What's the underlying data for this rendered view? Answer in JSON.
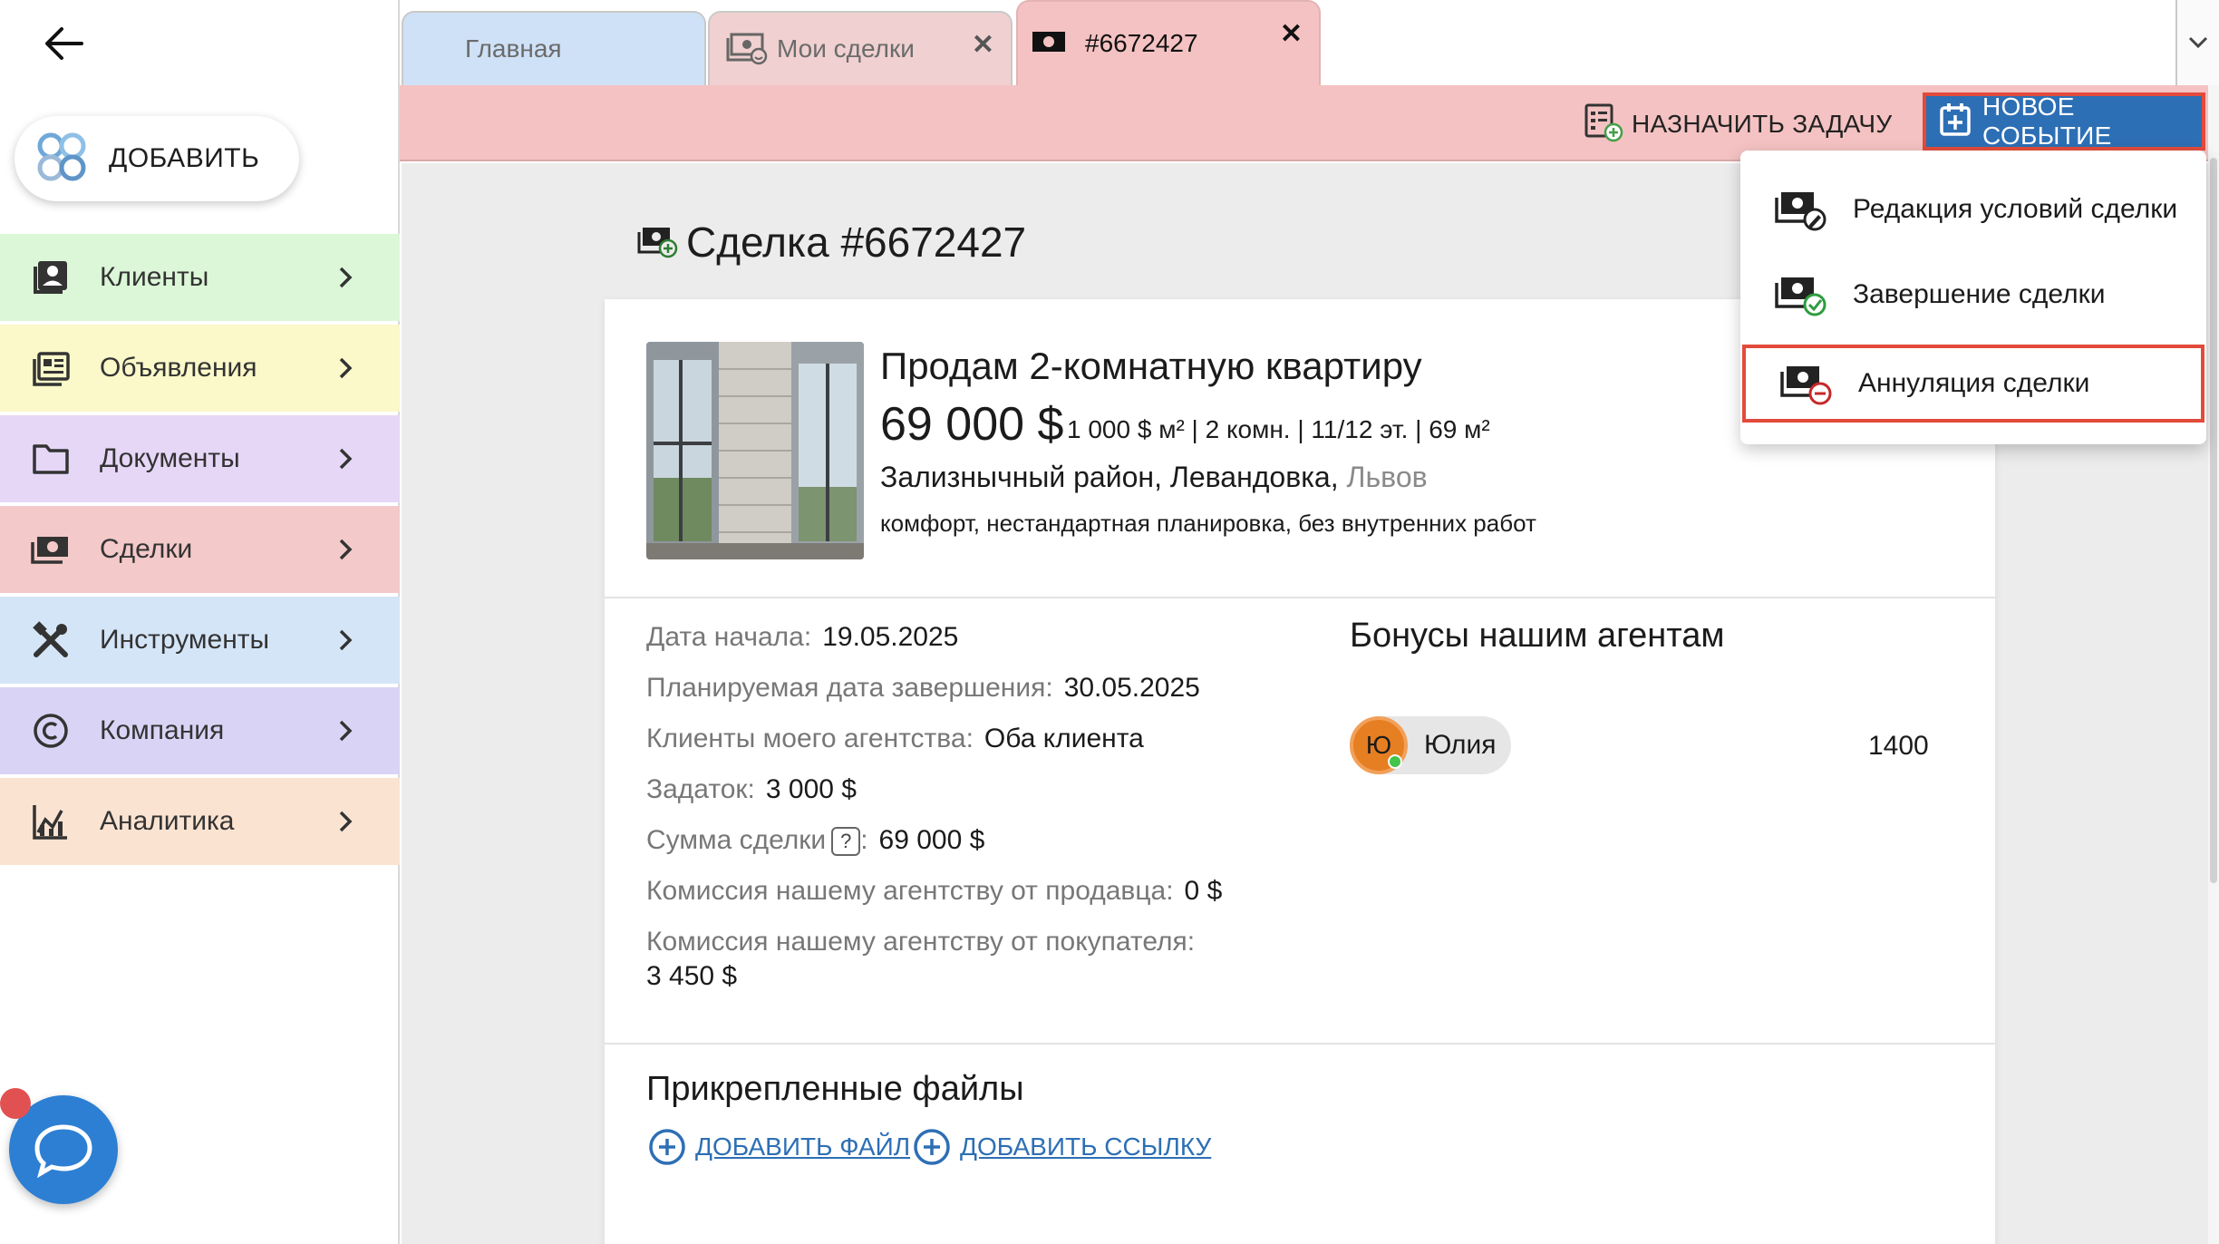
{
  "sidebar": {
    "add_label": "ДОБАВИТЬ",
    "items": [
      {
        "label": "Клиенты",
        "bg": "#dcf7d8",
        "icon": "contacts-icon"
      },
      {
        "label": "Объявления",
        "bg": "#fbf8c9",
        "icon": "listings-icon"
      },
      {
        "label": "Документы",
        "bg": "#e6d7f7",
        "icon": "folder-icon"
      },
      {
        "label": "Сделки",
        "bg": "#f4c9c9",
        "icon": "money-icon"
      },
      {
        "label": "Инструменты",
        "bg": "#d5e5f8",
        "icon": "tools-icon"
      },
      {
        "label": "Компания",
        "bg": "#d9d4f5",
        "icon": "copyright-icon"
      },
      {
        "label": "Аналитика",
        "bg": "#fbe3d2",
        "icon": "analytics-icon"
      }
    ]
  },
  "tabs": [
    {
      "label": "Главная"
    },
    {
      "label": "Мои сделки",
      "close": "✕"
    },
    {
      "label": "#6672427",
      "close": "✕"
    }
  ],
  "toolbar": {
    "assign_label": "НАЗНАЧИТЬ ЗАДАЧУ",
    "new_event_label": "НОВОЕ СОБЫТИЕ"
  },
  "dropdown": {
    "items": [
      {
        "label": "Редакция условий сделки"
      },
      {
        "label": "Завершение сделки"
      },
      {
        "label": "Аннуляция сделки"
      }
    ]
  },
  "page": {
    "title": "Сделка #6672427"
  },
  "listing": {
    "title": "Продам 2-комнатную квартиру",
    "price": "69 000 $",
    "meta": "1 000 $ м² | 2 комн. | 11/12 эт. | 69 м²",
    "location": "Зализнычный район, Левандовка,",
    "city": "Львов",
    "description": "комфорт, нестандартная планировка, без внутренних работ"
  },
  "details": {
    "start_label": "Дата начала:",
    "start_value": "19.05.2025",
    "planned_label": "Планируемая дата завершения:",
    "planned_value": "30.05.2025",
    "clients_label": "Клиенты моего агентства:",
    "clients_value": "Оба клиента",
    "deposit_label": "Задаток:",
    "deposit_value": "3 000 $",
    "sum_label": "Сумма сделки",
    "sum_help": "?",
    "sum_colon": ":",
    "sum_value": "69 000 $",
    "seller_comm_label": "Комиссия нашему агентству от продавца:",
    "seller_comm_value": "0 $",
    "buyer_comm_label": "Комиссия нашему агентству от покупателя:",
    "buyer_comm_value": "3 450 $"
  },
  "bonus": {
    "title": "Бонусы нашим агентам",
    "agent_initial": "Ю",
    "agent_name": "Юлия",
    "amount": "1400"
  },
  "files": {
    "title": "Прикрепленные файлы",
    "add_file": "ДОБАВИТЬ ФАЙЛ",
    "add_link": "ДОБАВИТЬ ССЫЛКУ"
  }
}
